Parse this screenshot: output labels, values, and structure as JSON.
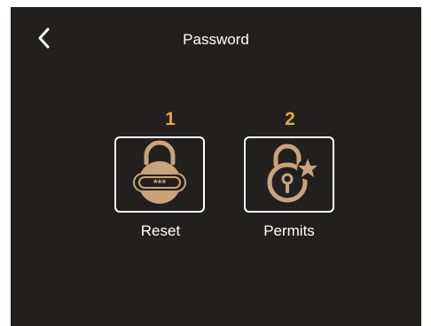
{
  "header": {
    "title": "Password",
    "back_icon": "chevron-left-icon"
  },
  "options": [
    {
      "number": "1",
      "label": "Reset",
      "icon": "padlock-password-icon"
    },
    {
      "number": "2",
      "label": "Permits",
      "icon": "padlock-star-icon"
    }
  ],
  "colors": {
    "background": "#221f1f",
    "accent": "#e8a53c",
    "icon": "#c9a47a",
    "text": "#ffffff"
  }
}
